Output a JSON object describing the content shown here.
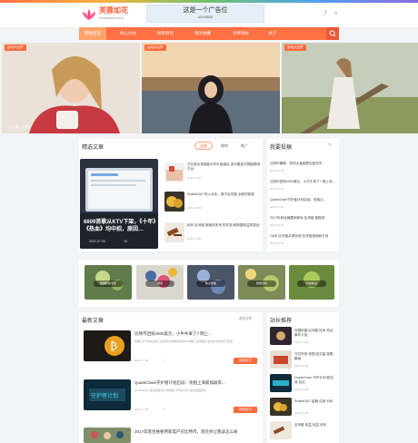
{
  "brand": {
    "name": "芙蓉如花",
    "tagline": "FURONGRUHUA"
  },
  "ad": {
    "title": "这是一个广告位",
    "subtitle": "AD168688"
  },
  "nav": {
    "items": [
      "网站首页",
      "新心分站",
      "财商资讯",
      "我的收藏",
      "世界目标",
      "关于"
    ],
    "active": 0
  },
  "slides": [
    {
      "tag": "运动大比拼",
      "caption": "《大漠》报道"
    },
    {
      "tag": "运动大比拼",
      "caption": ""
    },
    {
      "tag": "运动大比拼",
      "caption": ""
    }
  ],
  "featured": {
    "title": "精选文章",
    "tabs": [
      "全部",
      "独特",
      "推广"
    ],
    "hero": {
      "title": "6609首歌从KTV下架，《十年》《热血》均中招，原因…",
      "date": "2021-07-05",
      "views": "25"
    },
    "list": [
      {
        "title": "万亿商业帝国成为华Ⅲ 破滅后 该中国官方数据表明平台",
        "date": "2021-07-05"
      },
      {
        "title": "SnakeDAO 抢入分析，属于区块链 全新的贴钱",
        "date": "2021-07-05"
      },
      {
        "title": "权布 区块链 被推到未来 的宏观 和数据收益的挑战",
        "date": "2021-07-05"
      }
    ]
  },
  "hot": {
    "title": "我要投稿",
    "items": [
      {
        "title": "比特币暴跌，机构大量抛售加密货币，",
        "date": "2021-07-05"
      },
      {
        "title": "比特币回到4000美元，小牛牛来了? 网上消…",
        "date": "2021-07-05"
      },
      {
        "title": "QuarkChain守护者计划启动，亮相云…",
        "date": "2021-07-05"
      },
      {
        "title": "2017年底合格要用家电 区块链 被推到",
        "date": "2021-07-05"
      },
      {
        "title": "GMD 区块链共享到底 区块链落地新方向",
        "date": "2021-07-05"
      }
    ]
  },
  "categories": [
    "金融科技专区",
    "游戏",
    "热点聚焦",
    "财经分析",
    "科技前沿"
  ],
  "latest": {
    "title": "最新文章",
    "more": "更多文章",
    "items": [
      {
        "title": "比特币回到4000美元、小牛牛来了? 网上...",
        "summary": "另据公众号消息显示 比特币价格重新回到4000美元 新闻显示资本的 新增资产配置",
        "date": "2021-07-05",
        "views": "1",
        "btn": "阅读全文"
      },
      {
        "title": "QuarkChain守护者计划启动、亮相上海新加坡等...",
        "summary": "QuarkChain 区块链技术公司发起 守护者计划 本次亮相多地",
        "date": "2021-07-05",
        "views": "5",
        "btn": "阅读全文"
      },
      {
        "title": "2017年底合格要用家电产买比特币，现在你让我该怎么样",
        "summary": "",
        "date": "",
        "views": "",
        "btn": ""
      }
    ]
  },
  "recommend": {
    "title": "站长推荐",
    "items": [
      {
        "title": "外国科普 区块链 技术 热点事件介绍",
        "date": "2021-07-05"
      },
      {
        "title": "万亿市场 帝国 成交量 政策解读",
        "date": "2021-07-05"
      },
      {
        "title": "QuarkChain 守护计划 新加坡 站点",
        "date": "2021-07-05"
      },
      {
        "title": "SnakeDAO 金融 应用 分析",
        "date": "2021-07-05"
      },
      {
        "title": "区块链 收益 权益 体系",
        "date": ""
      }
    ]
  },
  "colors": {
    "accent": "#ff6a3c",
    "nav": "#ff7043"
  }
}
